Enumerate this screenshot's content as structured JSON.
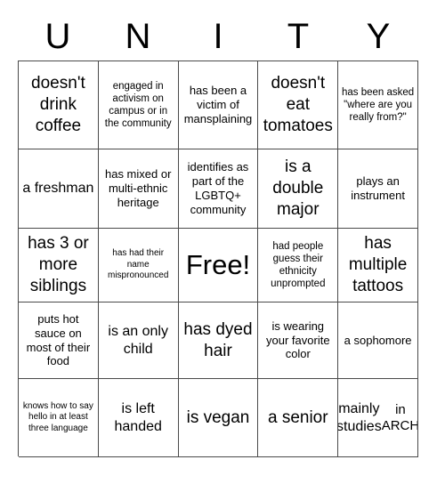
{
  "header": {
    "letters": [
      "U",
      "N",
      "I",
      "T",
      "Y"
    ],
    "title": "UNITY"
  },
  "colors": {
    "background": "#ffffff",
    "grid_border": "#4a4a4a",
    "text": "#000000"
  },
  "grid": {
    "rows": 5,
    "columns": 5,
    "cells": [
      {
        "text": "doesn't drink coffee",
        "size": "xl"
      },
      {
        "text": "engaged in activism on campus or in the community",
        "size": "s"
      },
      {
        "text": "has been a victim of mansplaining",
        "size": "m"
      },
      {
        "text": "doesn't eat tomatoes",
        "size": "xl"
      },
      {
        "text": "has been asked \"where are you really from?\"",
        "size": "s"
      },
      {
        "text": "a freshman",
        "size": "l"
      },
      {
        "text": "has mixed or multi-ethnic heritage",
        "size": "m"
      },
      {
        "text": "identifies as part of the LGBTQ+ community",
        "size": "m"
      },
      {
        "text": "is a double major",
        "size": "xl"
      },
      {
        "text": "plays an instrument",
        "size": "m"
      },
      {
        "text": "has 3 or more siblings",
        "size": "xl"
      },
      {
        "text": "has had their name mispronounced",
        "size": "xs"
      },
      {
        "text": "Free!",
        "size": "free"
      },
      {
        "text": "had people guess their ethnicity unprompted",
        "size": "s"
      },
      {
        "text": "has multiple tattoos",
        "size": "xl"
      },
      {
        "text": "puts hot sauce on most of their food",
        "size": "m"
      },
      {
        "text": "is an only child",
        "size": "l"
      },
      {
        "text": "has dyed hair",
        "size": "xl"
      },
      {
        "text": "is wearing your favorite color",
        "size": "m"
      },
      {
        "text": "a sophomore",
        "size": "m"
      },
      {
        "text": "knows how to say hello in at least three language",
        "size": "xs"
      },
      {
        "text": "is left handed",
        "size": "l"
      },
      {
        "text": "is vegan",
        "size": "xl"
      },
      {
        "text": "a senior",
        "size": "xl"
      },
      {
        "text": "mainly studies",
        "sub_text": "in ARCH",
        "size": "l"
      }
    ]
  }
}
